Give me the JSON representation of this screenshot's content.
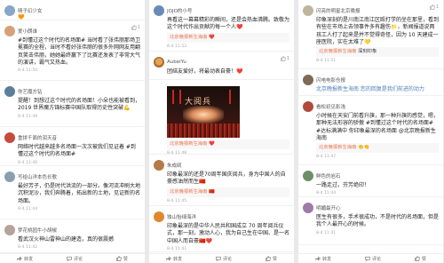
{
  "columns": [
    {
      "comments": [
        {
          "name": "晴子幻少女",
          "likes": "",
          "text": "🧡",
          "time": "8-4 11:52",
          "avatar_color": "#8aa6c8"
        },
        {
          "name": "爱小朗谁",
          "likes": "1",
          "text": "#到懂过这个时代的名场面# 当时看了张伟丽那场卫冕赛的全程，当时不看好张伟丽的很多外网网友用翻页笑击伟丽，她她最终赢下了比赛还发表了非常大气的演讲，霸气又热血。",
          "time": "8-4 11:50",
          "avatar_color": "#d6a07a"
        },
        {
          "name": "你艺魔方钻",
          "likes": "",
          "text": "提醒！到想过这个时代的名场面！小朵也能被看到，2019 世界魔方锦标赛中国队取得历史性突破💪",
          "time": "8-4 11:49",
          "avatar_color": "#5d7e9a"
        },
        {
          "name": "重拼千面的润天音",
          "likes": "",
          "text": "网络时代越来越多名场面一次次被我们见证着 #到懂过这个时代的名场面#",
          "time": "8-4 11:46",
          "avatar_color": "#c64b3c"
        },
        {
          "name": "写给山洋本色长歌",
          "likes": "",
          "text": "最好芳子，仍是时代洪流的一部分。像河流冲刷大地沉积泥沙，我们奔腾着，拓出新的土地，见证新的名场面。",
          "time": "8-4 11:44",
          "avatar_color": "#889fb0"
        },
        {
          "name": "梦花桃园牛小胡椒",
          "likes": "",
          "text": "看武汉火神山雷神山的建造，真的很震撼",
          "time": "8-4 11:42",
          "avatar_color": "#b5a29a"
        }
      ],
      "bar": {
        "share": "转发",
        "comment": "评论",
        "like": "赞"
      }
    },
    {
      "comments": [
        {
          "name": "JOJO的小号",
          "likes": "",
          "text": "再看这一幕幕精彩的瞬间，还是会热血沸腾。致敬为这个时代作出贡献的每一个人❤️",
          "time": "8-4 11:52",
          "reply_author": "北京晚报新生海南",
          "reply_text": "❤️",
          "avatar_color": "#6b8bb5"
        },
        {
          "name": "AubeiYu",
          "likes": "1",
          "text": "团结友爱好，将最动表自豪！❤️",
          "time": "8-4 11:50",
          "reply_author": "",
          "reply_text": "",
          "avatar_color": "dog"
        },
        {
          "name": "",
          "likes": "",
          "text": "",
          "time": "",
          "photo_caption": "大阅兵",
          "avatar_color": "#000"
        },
        {
          "name": "北京晚报新生海南",
          "likes": "",
          "text": "❤️",
          "time": "8-4 11:48",
          "avatar_color": "#3b5b8a"
        },
        {
          "name": "朱成硕",
          "likes": "",
          "text": "印象最深的还是70周年国庆阅兵，身为中国人的自豪感油然而生🇨🇳",
          "time": "8-4 11:45",
          "reply_author": "北京晚报新生海南",
          "reply_text": "🇨🇳",
          "avatar_color": "#b47b48"
        },
        {
          "name": "独山怡绿海洋",
          "likes": "",
          "text": "印象最深的是中华人民共和国成立 70 周年阅兵仪式，那一刻，激动人心，我为自己生在中国、是一名中国人而自豪🇨🇳❤️",
          "time": "8-4 11:41",
          "avatar_color": "#e0882e"
        }
      ],
      "bar": {
        "share": "转发",
        "comment": "评论",
        "like": "赞"
      }
    },
    {
      "comments": [
        {
          "name": "闪亮的明星北京晚报",
          "likes": "1",
          "text": "印象深刻的是川南江南江区殴打学的坐在那里，看到有些在市场上去领事件多有趣伤📁，新闻报道说两孩工人打了起来是并不觉得奇怪，因为 10 天建成一座医院，实在太难了💛",
          "time": "8-4 11:51",
          "reply_author": "北京晚报新生海南",
          "reply_text": "深刻印象",
          "avatar_color": "#c0b49e"
        },
        {
          "name": "闪电电影仓报",
          "likes": "",
          "text": "北京晚报新生海南 您的回复是我们前进的动力",
          "time": "8-4 11:49",
          "avatar_color": "#7f6a58"
        },
        {
          "name": "看松初见影浅",
          "likes": "",
          "text": "小时候在天安门前看升旗，那一种升旗的感觉，嗯，那种无法形容的骄傲 #到懂过这个时代的名场面# #达标满满中 你印象最深的名场面 @北京晚报新生海南",
          "time": "8-4 11:47",
          "reply_author": "北京晚报新生海南",
          "reply_text": "👏👏",
          "avatar_color": "#b04a3c"
        },
        {
          "name": "鲜色的岩石",
          "likes": "",
          "text": "一路走过，芬芳绝印！",
          "time": "8-4 11:44",
          "avatar_color": "#6f8f6a"
        },
        {
          "name": "明媚最开心",
          "likes": "",
          "text": "医生有很多，手术很成功，不是时代的名场面，但是我个人最开心的时候。",
          "time": "8-4 11:41",
          "avatar_color": "#a07aa8"
        }
      ],
      "bar": {
        "share": "转发",
        "comment": "评论",
        "like": "赞"
      }
    }
  ]
}
